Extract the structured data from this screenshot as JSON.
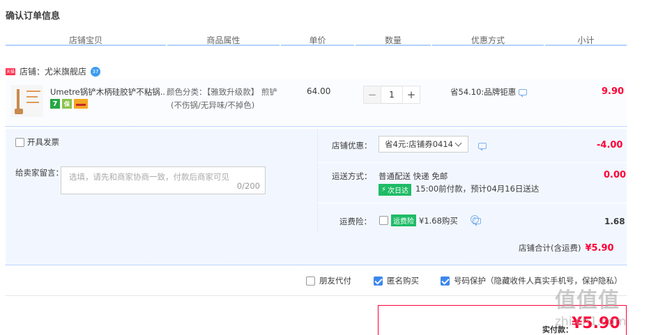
{
  "page": {
    "title": "确认订单信息"
  },
  "columns": [
    "店铺宝贝",
    "商品属性",
    "单价",
    "数量",
    "优惠方式",
    "小计"
  ],
  "shop": {
    "logo_text": "天猫",
    "label": "店铺：尤米旗舰店",
    "badge": "37"
  },
  "item": {
    "name": "Umetre锅铲木柄硅胶铲不粘锅...",
    "tags": [
      "7",
      "保"
    ],
    "attr_line1": "颜色分类：【雅致升级款】 煎铲",
    "attr_line2": "(不伤锅/无异味/不掉色)",
    "price": "64.00",
    "qty_minus": "−",
    "qty": "1",
    "qty_plus": "+",
    "discount": "省54.10:品牌钜惠",
    "subtotal": "9.90"
  },
  "invoice": {
    "label": "开具发票"
  },
  "message": {
    "label": "给卖家留言：",
    "placeholder": "选填，请先和商家协商一致，付款后商家可见",
    "counter": "0/200"
  },
  "shop_coupon": {
    "label": "店铺优惠：",
    "value": "省4元:店铺券0414",
    "amount": "-4.00"
  },
  "shipping": {
    "label": "运送方式：",
    "method": "普通配送 快递 免邮",
    "badge": "次日达",
    "eta": "15:00前付款，预计04月16日送达",
    "amount": "0.00"
  },
  "insurance": {
    "label": "运费险：",
    "badge": "运费险",
    "price": "¥1.68购买",
    "amount": "1.68"
  },
  "shop_total": {
    "label": "店铺合计(含运费)",
    "amount": "¥5.90"
  },
  "options": {
    "friend_pay": "朋友代付",
    "anonymous": "匿名购买",
    "number_protect": "号码保护（隐藏收件人真实手机号，保护隐私）"
  },
  "payment": {
    "label": "实付款：",
    "amount": "¥5.90"
  },
  "watermark": {
    "logo": "值值值",
    "site": "zhi.ch1.com"
  },
  "colors": {
    "accent_red": "#ff0036",
    "header_line": "#b2d1ff",
    "panel_bg": "#f2f7ff",
    "checkbox_blue": "#3c87ee",
    "badge_green": "#1ebc66"
  }
}
